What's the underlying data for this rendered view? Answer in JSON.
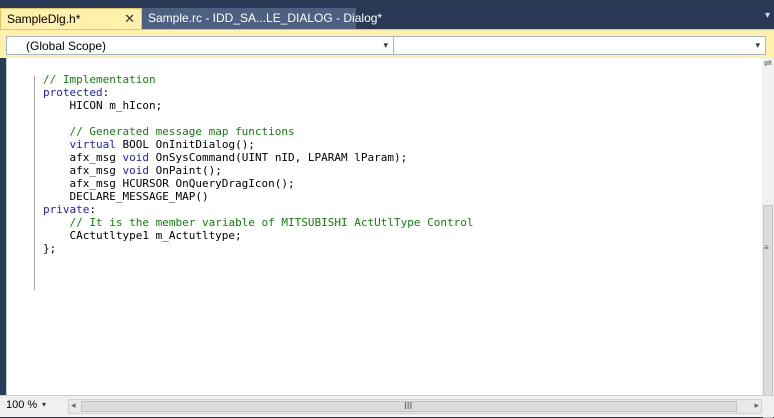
{
  "tabs": [
    {
      "label": "SampleDlg.h*",
      "active": true,
      "close_glyph": "✕"
    },
    {
      "label": "Sample.rc - IDD_SA...LE_DIALOG - Dialog*",
      "active": false
    }
  ],
  "scope_dropdown": {
    "value": "(Global Scope)"
  },
  "members_dropdown": {
    "value": ""
  },
  "code_lines": [
    [
      {
        "t": "// Implementation",
        "c": "cm"
      }
    ],
    [
      {
        "t": "protected",
        "c": "kw"
      },
      {
        "t": ":"
      }
    ],
    [
      {
        "t": "    HICON m_hIcon;"
      }
    ],
    [
      {
        "t": ""
      }
    ],
    [
      {
        "t": "    "
      },
      {
        "t": "// Generated message map functions",
        "c": "cm"
      }
    ],
    [
      {
        "t": "    "
      },
      {
        "t": "virtual",
        "c": "kw"
      },
      {
        "t": " BOOL OnInitDialog();"
      }
    ],
    [
      {
        "t": "    afx_msg "
      },
      {
        "t": "void",
        "c": "kw"
      },
      {
        "t": " OnSysCommand(UINT nID, LPARAM lParam);"
      }
    ],
    [
      {
        "t": "    afx_msg "
      },
      {
        "t": "void",
        "c": "kw"
      },
      {
        "t": " OnPaint();"
      }
    ],
    [
      {
        "t": "    afx_msg HCURSOR OnQueryDragIcon();"
      }
    ],
    [
      {
        "t": "    DECLARE_MESSAGE_MAP()"
      }
    ],
    [
      {
        "t": "private",
        "c": "kw"
      },
      {
        "t": ":"
      }
    ],
    [
      {
        "t": "    "
      },
      {
        "t": "// It is the member variable of MITSUBISHI ActUtlType Control",
        "c": "cm"
      }
    ],
    [
      {
        "t": "    CActutltype1 m_Actutltype;"
      }
    ],
    [
      {
        "t": "};"
      }
    ]
  ],
  "status": {
    "zoom": "100 %"
  },
  "icons": {
    "dropdown": "▾",
    "scroll_left": "◂",
    "scroll_right": "▸",
    "grip_h": "III",
    "grip_v": "≡",
    "split": "⇌"
  },
  "colors": {
    "keyword": "#1a1ad6",
    "comment": "#13800c",
    "active_tab": "#fff1ab"
  }
}
